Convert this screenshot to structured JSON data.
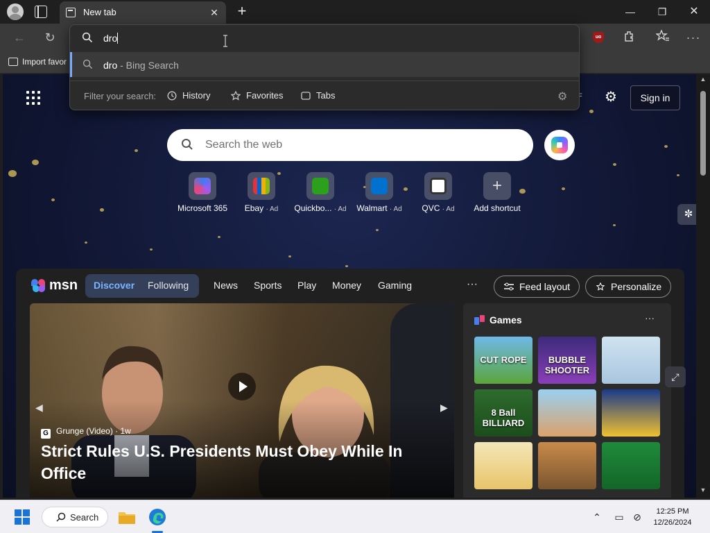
{
  "browser": {
    "tab_title": "New tab",
    "favorites_import_label": "Import favor"
  },
  "omnibox": {
    "typed_text": "dro",
    "suggestion_query": "dro",
    "suggestion_source": " - Bing Search",
    "filter_label": "Filter your search:",
    "filters": [
      {
        "label": "History",
        "icon": "history-icon"
      },
      {
        "label": "Favorites",
        "icon": "star-icon"
      },
      {
        "label": "Tabs",
        "icon": "tabs-icon"
      }
    ]
  },
  "newtab": {
    "search_placeholder": "Search the web",
    "signin_label": "Sign in",
    "partial_text": "F",
    "shortcuts": [
      {
        "label": "Microsoft 365",
        "ad": "",
        "icon": "microsoft-365-icon"
      },
      {
        "label": "Ebay",
        "ad": "· Ad",
        "icon": "ebay-icon"
      },
      {
        "label": "Quickbo...",
        "ad": "· Ad",
        "icon": "quickbooks-icon"
      },
      {
        "label": "Walmart",
        "ad": "· Ad",
        "icon": "walmart-icon"
      },
      {
        "label": "QVC",
        "ad": "· Ad",
        "icon": "qvc-icon"
      },
      {
        "label": "Add shortcut",
        "ad": "",
        "icon": "plus-icon"
      }
    ]
  },
  "msn": {
    "logo_text": "msn",
    "tabs": {
      "discover": "Discover",
      "following": "Following"
    },
    "nav": [
      "News",
      "Sports",
      "Play",
      "Money",
      "Gaming"
    ],
    "more": "···",
    "feed_layout_label": "Feed layout",
    "personalize_label": "Personalize",
    "hero": {
      "source": "Grunge (Video)",
      "age": "· 1w",
      "headline": "Strict Rules U.S. Presidents Must Obey While In Office"
    },
    "games": {
      "title": "Games",
      "more": "···",
      "tiles": [
        {
          "label": "CUT ROPE",
          "name": "game-cut-the-rope"
        },
        {
          "label": "BUBBLE SHOOTER",
          "name": "game-bubble-shooter"
        },
        {
          "label": "",
          "name": "game-stickman-thief"
        },
        {
          "label": "8 Ball BILLIARD",
          "name": "game-8-ball-billiard"
        },
        {
          "label": "",
          "name": "game-girl-character"
        },
        {
          "label": "",
          "name": "game-block-puzzle"
        },
        {
          "label": "",
          "name": "game-cat-bees"
        },
        {
          "label": "",
          "name": "game-deer-hunter"
        },
        {
          "label": "",
          "name": "game-solitaire"
        }
      ]
    }
  },
  "taskbar": {
    "search_label": "Search",
    "time": "12:25 PM",
    "date": "12/26/2024"
  },
  "colors": {
    "accent_blue": "#7aa8ff",
    "msn_discover": "#7ab4ff",
    "taskbar_bg": "#f0f0f4"
  }
}
